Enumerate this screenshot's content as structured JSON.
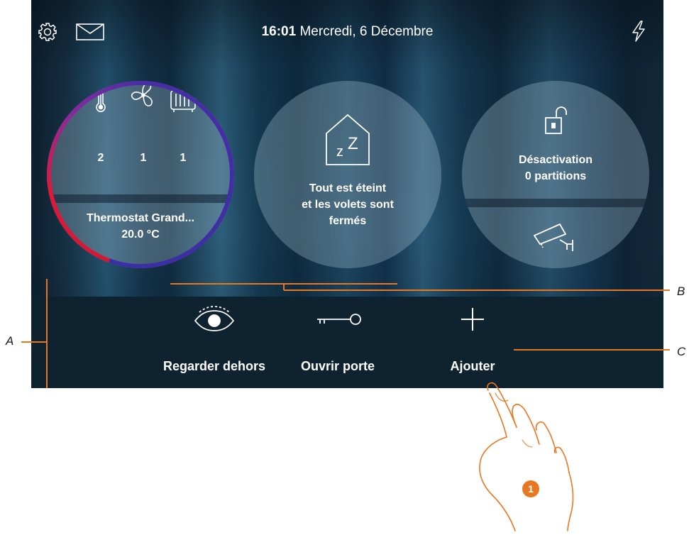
{
  "header": {
    "time": "16:01",
    "date": "Mercredi, 6 Décembre",
    "icons": [
      "gear-icon",
      "mail-icon",
      "power-icon"
    ]
  },
  "thermostat": {
    "counts": {
      "thermometer": "2",
      "fan": "1",
      "radiator": "1"
    },
    "name": "Thermostat Grand...",
    "temperature": "20.0 °C",
    "ring_colors": [
      "#d01932",
      "#3b2ea5"
    ]
  },
  "scenario": {
    "icon_text": "z",
    "icon_text_big": "Z",
    "line1": "Tout est éteint",
    "line2": "et les volets sont",
    "line3": "fermés"
  },
  "alarm": {
    "line1": "Désactivation",
    "line2": "0 partitions"
  },
  "actions": [
    {
      "label": "Regarder dehors",
      "icon": "eye-icon"
    },
    {
      "label": "Ouvrir porte",
      "icon": "key-icon"
    },
    {
      "label": "Ajouter",
      "icon": "plus-icon"
    }
  ],
  "callouts": {
    "a": "A",
    "b": "B",
    "c": "C"
  },
  "step": "1",
  "colors": {
    "accent": "#e87722",
    "bottom_bar": "#0f2230"
  }
}
